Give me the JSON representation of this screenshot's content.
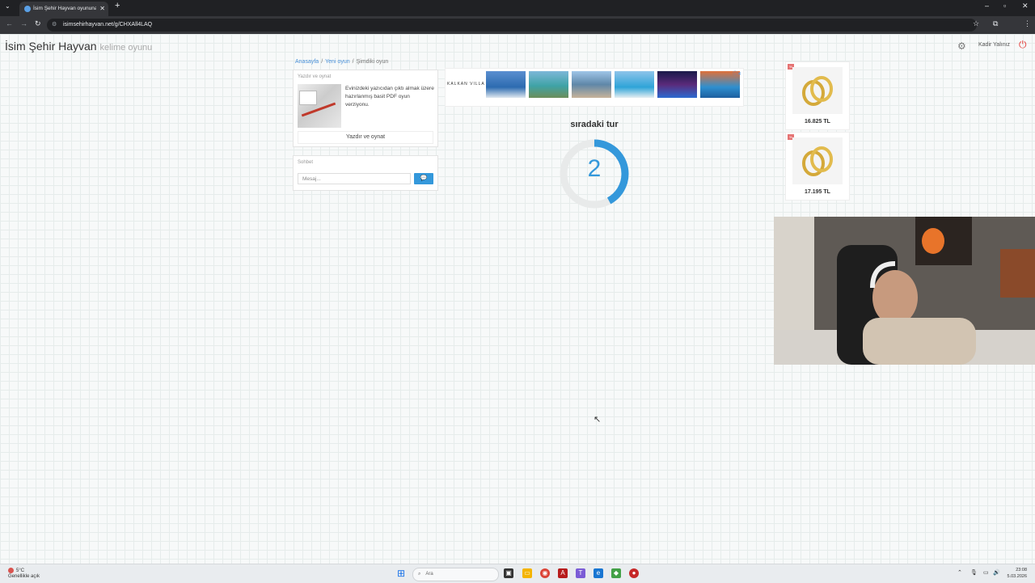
{
  "browser": {
    "tab_title": "İsim Şehir Hayvan oyununa kat",
    "url": "isimsehirhayvan.net/g/CHXAll4LAQ"
  },
  "header": {
    "brand": "İsim Şehir Hayvan",
    "brand_sub": "kelime oyunu",
    "user": "Kadir Yalınız"
  },
  "breadcrumb": {
    "home": "Anasayfa",
    "new_game": "Yeni oyun",
    "current": "Şimdiki oyun"
  },
  "print_panel": {
    "heading": "Yazdır ve oynat",
    "text": "Evinizdeki yazıcıdan çıktı almak üzere hazırlanmış basit PDF oyun verziyonu.",
    "button": "Yazdır ve oynat"
  },
  "chat_panel": {
    "heading": "Sohbet",
    "placeholder": "Mesaj..."
  },
  "ad": {
    "logo": "KALKAN VILLA",
    "close_icon": "ad-close-icon"
  },
  "game": {
    "title": "sıradaki tur",
    "countdown": "2",
    "progress": 0.42,
    "accent": "#3498db"
  },
  "products": [
    {
      "price": "16.825 TL"
    },
    {
      "price": "17.195 TL"
    }
  ],
  "taskbar": {
    "weather_temp": "5°C",
    "weather_text": "Genellikle açık",
    "search": "Ara",
    "time": "23:08",
    "date": "5.03.2026"
  }
}
